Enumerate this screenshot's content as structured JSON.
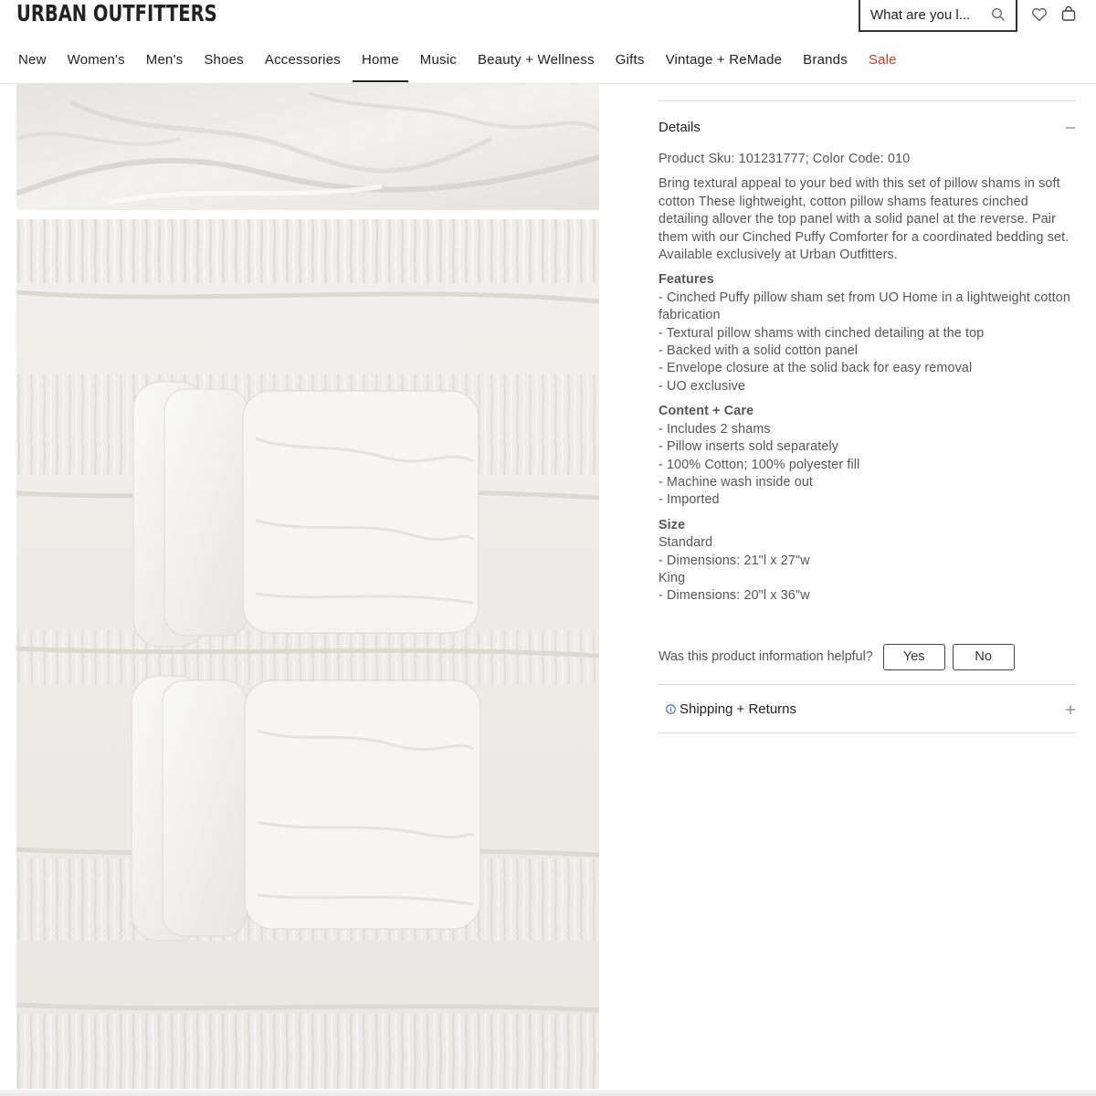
{
  "header": {
    "logo": "URBAN OUTFITTERS",
    "search_placeholder": "What are you l..."
  },
  "nav": [
    "New",
    "Women's",
    "Men's",
    "Shoes",
    "Accessories",
    "Home",
    "Music",
    "Beauty + Wellness",
    "Gifts",
    "Vintage + ReMade",
    "Brands",
    "Sale"
  ],
  "nav_active": "Home",
  "colors": {
    "sale": "#d23b1e",
    "text": "#222222",
    "body": "#555555",
    "info": "#1a5fb4"
  },
  "details": {
    "heading": "Details",
    "sku": "Product Sku: 101231777; Color Code: 010",
    "description": "Bring textural appeal to your bed with this set of pillow shams in soft cotton These lightweight, cotton pillow shams features cinched detailing allover the top panel with a solid panel at the reverse. Pair them with our Cinched Puffy Comforter for a coordinated bedding set. Available exclusively at Urban Outfitters.",
    "features_title": "Features",
    "features": [
      "- Cinched Puffy pillow sham set from UO Home in a lightweight cotton fabrication",
      "- Textural pillow shams with cinched detailing at the top",
      "- Backed with a solid cotton panel",
      "- Envelope closure at the solid back for easy removal",
      "- UO exclusive"
    ],
    "content_title": "Content + Care",
    "content": [
      "- Includes 2 shams",
      "- Pillow inserts sold separately",
      "- 100% Cotton; 100% polyester fill",
      "- Machine wash inside out",
      "- Imported"
    ],
    "size_title": "Size",
    "size": [
      "Standard",
      "- Dimensions: 21\"l x 27\"w",
      "King",
      "- Dimensions: 20\"l x 36\"w"
    ]
  },
  "helpful": {
    "question": "Was this product information helpful?",
    "yes": "Yes",
    "no": "No"
  },
  "shipping": {
    "label": "Shipping + Returns"
  },
  "icons": [
    "search-icon",
    "heart-icon",
    "bag-icon",
    "minus-icon",
    "plus-icon",
    "info-icon"
  ]
}
